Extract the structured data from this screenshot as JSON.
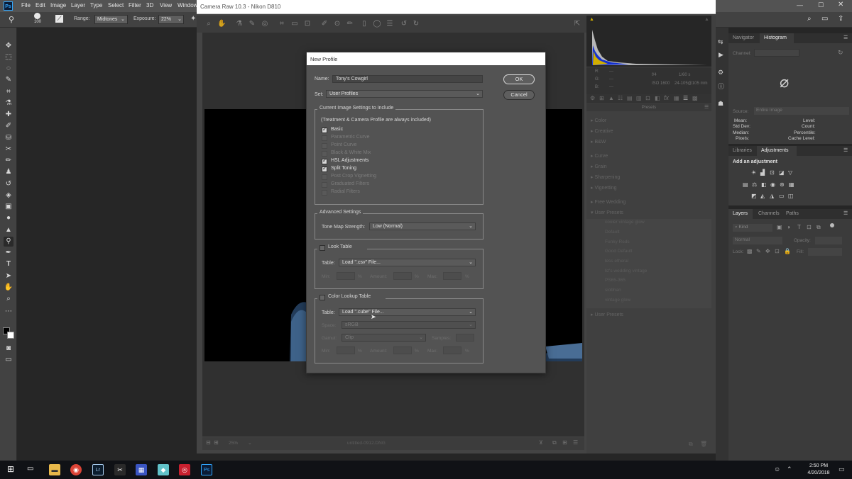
{
  "ps": {
    "logo": "Ps",
    "menu": [
      "File",
      "Edit",
      "Image",
      "Layer",
      "Type",
      "Select",
      "Filter",
      "3D",
      "View",
      "Window"
    ],
    "options": {
      "brush_size": "100",
      "range_label": "Range:",
      "range_value": "Midtones",
      "exposure_label": "Exposure:",
      "exposure_value": "22%"
    },
    "right": {
      "tabs1": [
        "Navigator",
        "Histogram"
      ],
      "channel_label": "Channel:",
      "source_label": "Source:",
      "source_value": "Entire Image",
      "stats_left": [
        "Mean:",
        "Std Dev:",
        "Median:",
        "Pixels:"
      ],
      "stats_right": [
        "Level:",
        "Count:",
        "Percentile:",
        "Cache Level:"
      ],
      "tabs2": [
        "Libraries",
        "Adjustments"
      ],
      "add_adjustment": "Add an adjustment",
      "tabs3": [
        "Layers",
        "Channels",
        "Paths"
      ],
      "kind_label": "Kind",
      "blend_mode": "Normal",
      "opacity_label": "Opacity:",
      "lock_label": "Lock:",
      "fill_label": "Fill:"
    }
  },
  "cr": {
    "title": "Camera Raw 10.3  -  Nikon D810",
    "zoom": "25%",
    "filename": "untitled-0912.DNG",
    "info": {
      "r": "R:",
      "g": "G:",
      "b": "B:",
      "dash": "---",
      "aperture": "f/4",
      "shutter": "1/60 s",
      "iso": "ISO 1600",
      "lens": "24-105@105 mm"
    },
    "presets_header": "Presets",
    "preset_groups": [
      "Color",
      "Creative",
      "B&W",
      "Curve",
      "Grain",
      "Sharpening",
      "Vignetting",
      "Free Wedding",
      "User Presets"
    ],
    "user_presets": [
      "cooler vintage glow",
      "Default",
      "Funky Reds",
      "Good Default",
      "less etheral",
      "liz's wedding vintage",
      "PS65-365",
      "siobhan",
      "vintage glow"
    ],
    "bottom_group": "User Presets"
  },
  "dialog": {
    "title": "New Profile",
    "name_label": "Name:",
    "name_value": "Tony's Cowgirl",
    "set_label": "Set:",
    "set_value": "User Profiles",
    "ok": "OK",
    "cancel": "Cancel",
    "current_settings": {
      "title": "Current Image Settings to Include",
      "note": "(Treatment & Camera Profile are always included)",
      "items": [
        {
          "label": "Basic",
          "checked": true,
          "enabled": true
        },
        {
          "label": "Parametric Curve",
          "checked": false,
          "enabled": false
        },
        {
          "label": "Point Curve",
          "checked": false,
          "enabled": false
        },
        {
          "label": "Black & White Mix",
          "checked": false,
          "enabled": false
        },
        {
          "label": "HSL Adjustments",
          "checked": true,
          "enabled": true
        },
        {
          "label": "Split Toning",
          "checked": true,
          "enabled": true
        },
        {
          "label": "Post Crop Vignetting",
          "checked": false,
          "enabled": false
        },
        {
          "label": "Graduated Filters",
          "checked": false,
          "enabled": false
        },
        {
          "label": "Radial Filters",
          "checked": false,
          "enabled": false
        }
      ]
    },
    "advanced": {
      "title": "Advanced Settings",
      "tone_map_label": "Tone Map Strength:",
      "tone_map_value": "Low (Normal)"
    },
    "look_table": {
      "title": "Look Table",
      "table_label": "Table:",
      "table_value": "Load \".csv\" File...",
      "min_label": "Min:",
      "amount_label": "Amount:",
      "max_label": "Max:",
      "pct": "%"
    },
    "color_lookup": {
      "title": "Color Lookup Table",
      "table_label": "Table:",
      "table_value": "Load \".cube\" File...",
      "space_label": "Space:",
      "space_value": "sRGB",
      "gamut_label": "Gamut:",
      "gamut_value": "Clip",
      "samples_label": "Samples:",
      "min_label": "Min:",
      "amount_label": "Amount:",
      "max_label": "Max:",
      "pct": "%"
    }
  },
  "taskbar": {
    "time": "2:50 PM",
    "date": "4/20/2018"
  },
  "colors": {
    "ps_accent": "#31a8ff",
    "dialog_bg": "#535353",
    "taskbar": "#101216"
  }
}
